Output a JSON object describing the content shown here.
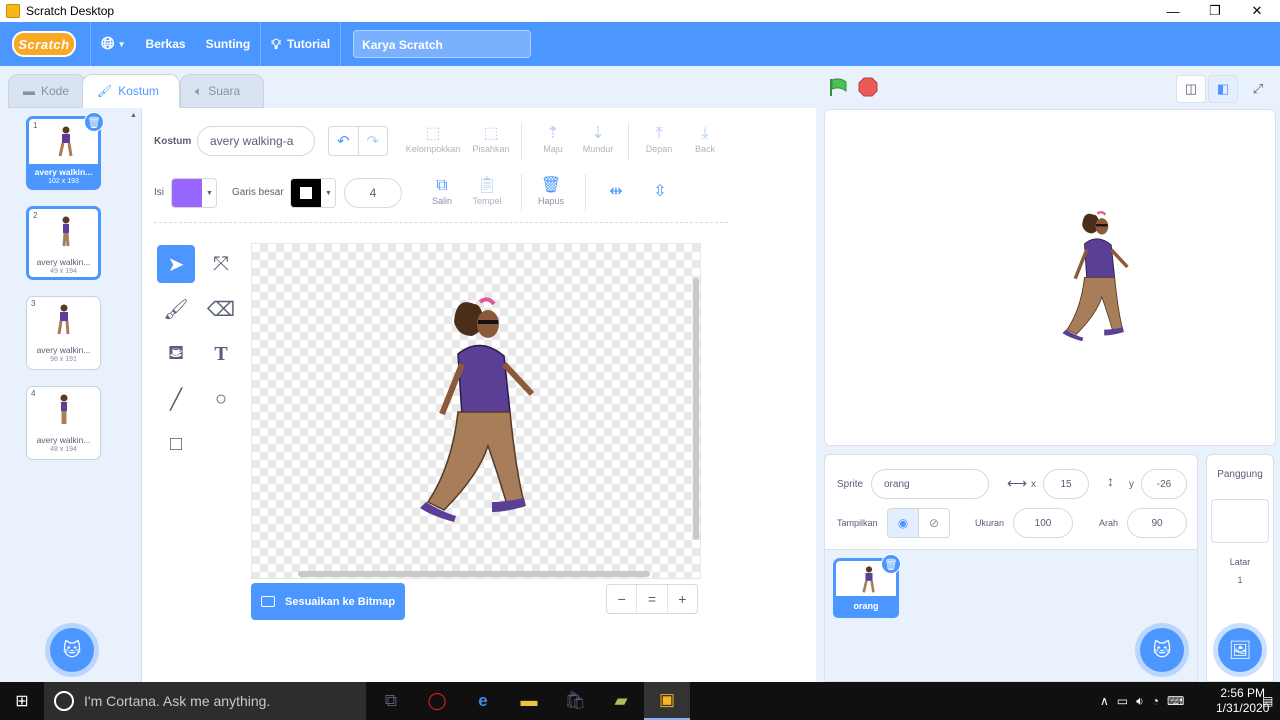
{
  "window": {
    "title": "Scratch Desktop",
    "minimize": "—",
    "maximize": "❐",
    "close": "✕"
  },
  "menubar": {
    "logo": "Scratch",
    "file": "Berkas",
    "edit": "Sunting",
    "tutorial": "Tutorial",
    "project_title": "Karya Scratch"
  },
  "tabs": [
    {
      "label": "Kode",
      "icon": "code-icon"
    },
    {
      "label": "Kostum",
      "icon": "brush-icon"
    },
    {
      "label": "Suara",
      "icon": "speaker-icon"
    }
  ],
  "costumes": [
    {
      "num": "1",
      "name": "avery walkin...",
      "size": "102 x 193"
    },
    {
      "num": "2",
      "name": "avery walkin...",
      "size": "49 x 194"
    },
    {
      "num": "3",
      "name": "avery walkin...",
      "size": "98 x 191"
    },
    {
      "num": "4",
      "name": "avery walkin...",
      "size": "48 x 194"
    }
  ],
  "editor": {
    "costume_label": "Kostum",
    "costume_name": "avery walking-a",
    "group": "Kelompokkan",
    "ungroup": "Pisahkan",
    "forward": "Maju",
    "backward": "Mundur",
    "front": "Depan",
    "back": "Back",
    "fill_label": "Isi",
    "fill_color": "#9966ff",
    "outline_label": "Garis besar",
    "outline_color": "#000000",
    "outline_width": "4",
    "copy": "Salin",
    "paste": "Tempel",
    "delete": "Hapus",
    "convert_bitmap": "Sesuaikan ke Bitmap",
    "zoom_out": "−",
    "zoom_reset": "=",
    "zoom_in": "+"
  },
  "sprite_info": {
    "sprite_label": "Sprite",
    "sprite_name": "orang",
    "x_label": "x",
    "x_value": "15",
    "y_label": "y",
    "y_value": "-26",
    "show_label": "Tampilkan",
    "size_label": "Ukuran",
    "size_value": "100",
    "direction_label": "Arah",
    "direction_value": "90"
  },
  "sprites": [
    {
      "name": "orang"
    }
  ],
  "stage_pane": {
    "title": "Panggung",
    "backdrops_label": "Latar",
    "backdrops_count": "1"
  },
  "taskbar": {
    "search_placeholder": "I'm Cortana. Ask me anything.",
    "time": "2:56 PM",
    "date": "1/31/2020"
  },
  "colors": {
    "accent": "#4c97ff",
    "menubar": "#4c97ff",
    "green_flag": "#4cbf56",
    "stop": "#ec5959"
  }
}
